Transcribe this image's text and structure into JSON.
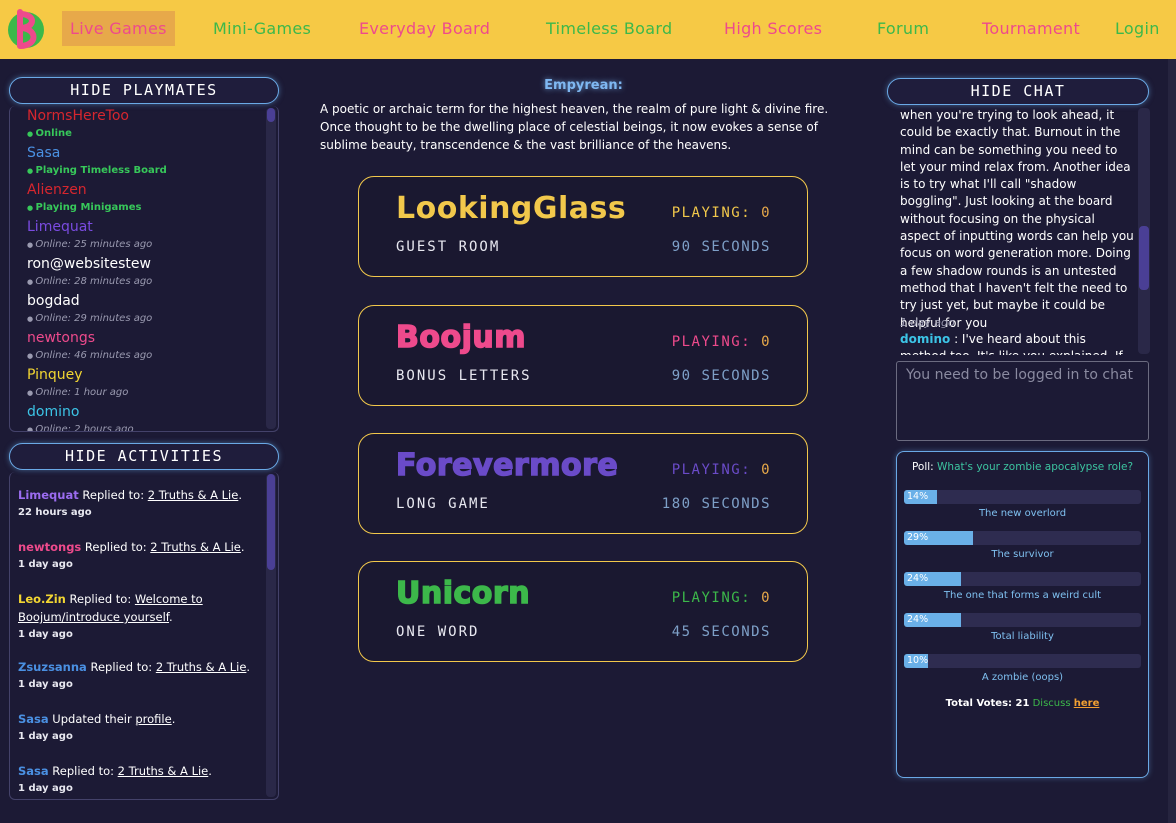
{
  "nav": {
    "logo_letter": "B",
    "items": [
      {
        "label": "Live Games",
        "color": "#ee4a8c"
      },
      {
        "label": "Mini-Games",
        "color": "#3cb84a"
      },
      {
        "label": "Everyday Board",
        "color": "#ee4a8c"
      },
      {
        "label": "Timeless Board",
        "color": "#3cb84a"
      },
      {
        "label": "High Scores",
        "color": "#ee4a8c"
      },
      {
        "label": "Forum",
        "color": "#3cb84a"
      },
      {
        "label": "Tournament",
        "color": "#ee4a8c"
      },
      {
        "label": "Login",
        "color": "#3cb84a"
      }
    ]
  },
  "playmates": {
    "toggle_label": "HIDE PLAYMATES",
    "items": [
      {
        "name": "NormsHereToo",
        "status": "Online",
        "color": "#d7262e",
        "online": true
      },
      {
        "name": "Sasa",
        "status": "Playing Timeless Board",
        "color": "#4a90e2",
        "online": true
      },
      {
        "name": "Alienzen",
        "status": "Playing Minigames",
        "color": "#d7262e",
        "online": true
      },
      {
        "name": "Limequat",
        "status": "Online: 25 minutes ago",
        "color": "#7a4be0",
        "online": false
      },
      {
        "name": "ron@websitestew",
        "status": "Online: 28 minutes ago",
        "color": "#ffffff",
        "online": false
      },
      {
        "name": "bogdad",
        "status": "Online: 29 minutes ago",
        "color": "#ffffff",
        "online": false
      },
      {
        "name": "newtongs",
        "status": "Online: 46 minutes ago",
        "color": "#ee4a8c",
        "online": false
      },
      {
        "name": "Pinquey",
        "status": "Online: 1 hour ago",
        "color": "#f2d632",
        "online": false
      },
      {
        "name": "domino",
        "status": "Online: 2 hours ago",
        "color": "#3cc4e6",
        "online": false
      }
    ]
  },
  "activities": {
    "toggle_label": "HIDE ACTIVITIES",
    "items": [
      {
        "user": "Limequat",
        "user_color": "#9b6cf0",
        "verb": " Replied to: ",
        "target": "2 Truths & A Lie",
        "target2": "",
        "end": ".",
        "time": "22 hours ago"
      },
      {
        "user": "newtongs",
        "user_color": "#ee4a8c",
        "verb": " Replied to: ",
        "target": "2 Truths & A Lie",
        "target2": "",
        "end": ".",
        "time": "1 day ago"
      },
      {
        "user": "Leo.Zin",
        "user_color": "#f2d632",
        "verb": " Replied to: ",
        "target": "Welcome to",
        "target2": "Boojum/introduce yourself",
        "end": ".",
        "time": "1 day ago"
      },
      {
        "user": "Zsuzsanna",
        "user_color": "#4a90e2",
        "verb": " Replied to: ",
        "target": "2 Truths & A Lie",
        "target2": "",
        "end": ".",
        "time": "1 day ago"
      },
      {
        "user": "Sasa",
        "user_color": "#4a90e2",
        "verb": " Updated their ",
        "target": "profile",
        "target2": "",
        "end": ".",
        "time": "1 day ago"
      },
      {
        "user": "Sasa",
        "user_color": "#4a90e2",
        "verb": " Replied to: ",
        "target": "2 Truths & A Lie",
        "target2": "",
        "end": ".",
        "time": "1 day ago"
      }
    ]
  },
  "word": {
    "title": "Empyrean:",
    "description": "A poetic or archaic term for the highest heaven, the realm of pure light & divine fire. Once thought to be the dwelling place of celestial beings, it now evokes a sense of sublime beauty, transcendence & the vast brilliance of the heavens."
  },
  "games": [
    {
      "name": "LookingGlass",
      "color": "#f2c84b",
      "outline": false,
      "playing_label": "PLAYING:",
      "playing_count": "0",
      "room": "GUEST ROOM",
      "time": "90 SECONDS"
    },
    {
      "name": "Boojum",
      "color": "#ee4a8c",
      "outline": true,
      "playing_label": "PLAYING:",
      "playing_count": "0",
      "room": "BONUS LETTERS",
      "time": "90 SECONDS"
    },
    {
      "name": "Forevermore",
      "color": "#6a4bc8",
      "outline": true,
      "playing_label": "PLAYING:",
      "playing_count": "0",
      "room": "LONG GAME",
      "time": "180 SECONDS"
    },
    {
      "name": "Unicorn",
      "color": "#3cb84a",
      "outline": true,
      "playing_label": "PLAYING:",
      "playing_count": "0",
      "room": "ONE WORD",
      "time": "45 SECONDS"
    }
  ],
  "chat": {
    "toggle_label": "HIDE CHAT",
    "message_text": "when you're trying to look ahead, it could be exactly that. Burnout in the mind can be something you need to let your mind relax from. Another idea is to try what I'll call \"shadow boggling\". Just looking at the board without focusing on the physical aspect of inputting words can help you focus on word generation more. Doing a few shadow rounds is an untested method that I haven't felt the need to try just yet, but maybe it could be helpful for you",
    "message_time": "1 day ago",
    "next_user": "domino",
    "next_text": " : I've heard about this method too. It's like you explained. If you give up",
    "input_placeholder": "You need to be logged in to chat"
  },
  "poll": {
    "label": "Poll: ",
    "question": "What's your zombie apocalypse role?",
    "options": [
      {
        "label": "The new overlord",
        "percent": 14,
        "percent_text": "14%"
      },
      {
        "label": "The survivor",
        "percent": 29,
        "percent_text": "29%"
      },
      {
        "label": "The one that forms a weird cult",
        "percent": 24,
        "percent_text": "24%"
      },
      {
        "label": "Total liability",
        "percent": 24,
        "percent_text": "24%"
      },
      {
        "label": "A zombie (oops)",
        "percent": 10,
        "percent_text": "10%"
      }
    ],
    "total_label": "Total Votes: 21",
    "discuss_label": " Discuss ",
    "here_label": "here"
  }
}
